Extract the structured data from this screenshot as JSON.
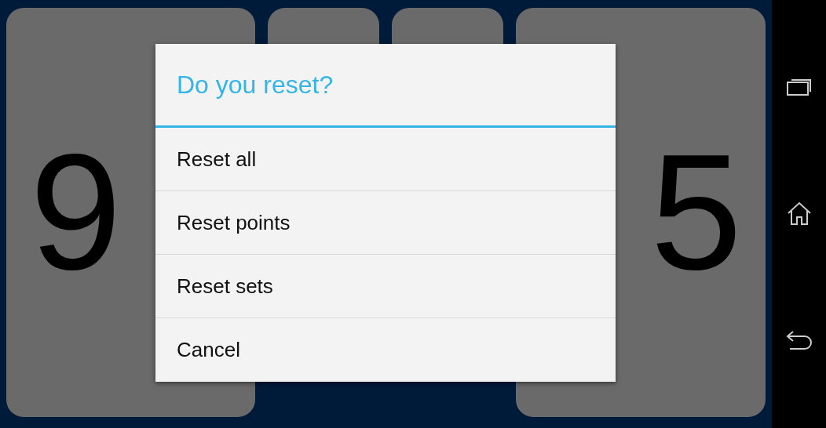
{
  "scoreboard": {
    "left_score": "9",
    "right_score": "5"
  },
  "dialog": {
    "title": "Do you reset?",
    "options": [
      {
        "label": "Reset all"
      },
      {
        "label": "Reset points"
      },
      {
        "label": "Reset sets"
      },
      {
        "label": "Cancel"
      }
    ]
  }
}
